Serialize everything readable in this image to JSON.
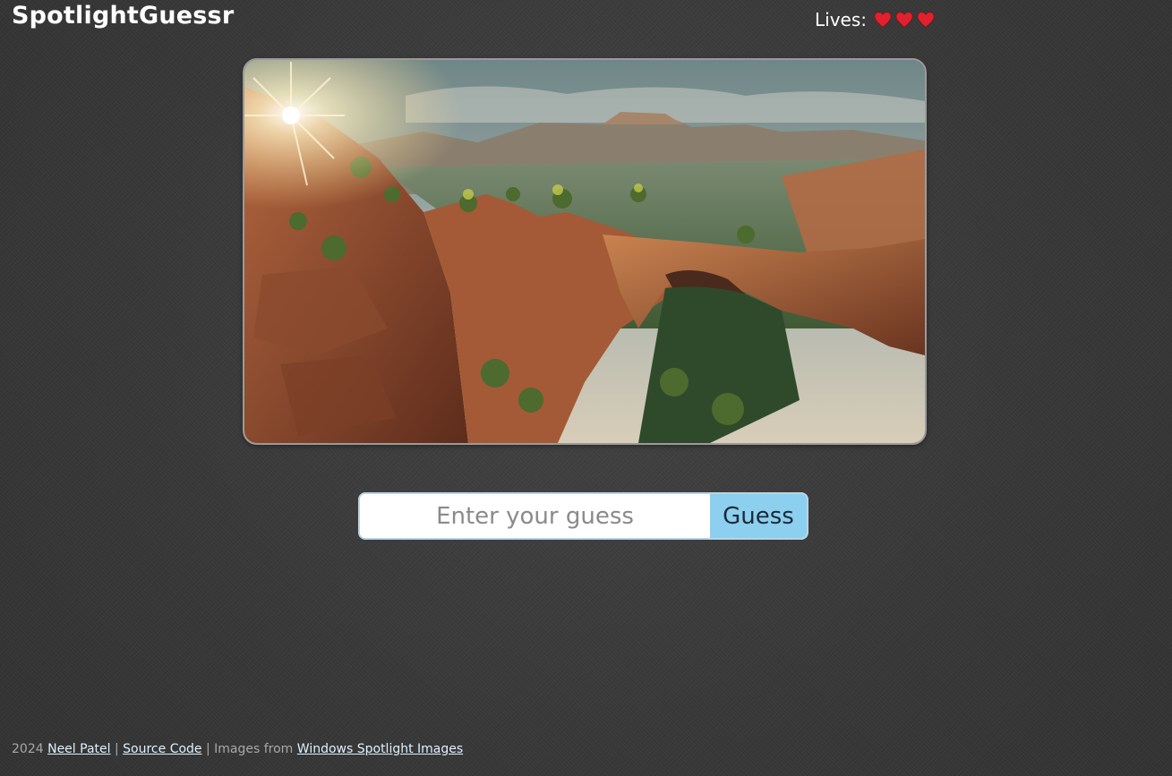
{
  "header": {
    "title": "SpotlightGuessr",
    "lives_label": "Lives:",
    "lives_count": 3,
    "heart_icon": "heart-icon",
    "heart_color": "#e0212e"
  },
  "photo": {
    "subject_icon": "landscape-photo"
  },
  "guess": {
    "placeholder": "Enter your guess",
    "button_label": "Guess",
    "accent_color": "#8ccfef"
  },
  "footer": {
    "year": "2024",
    "author_link": "Neel Patel",
    "sep1": "|",
    "source_link": "Source Code",
    "images_text": "| Images from",
    "images_link": "Windows Spotlight Images"
  }
}
